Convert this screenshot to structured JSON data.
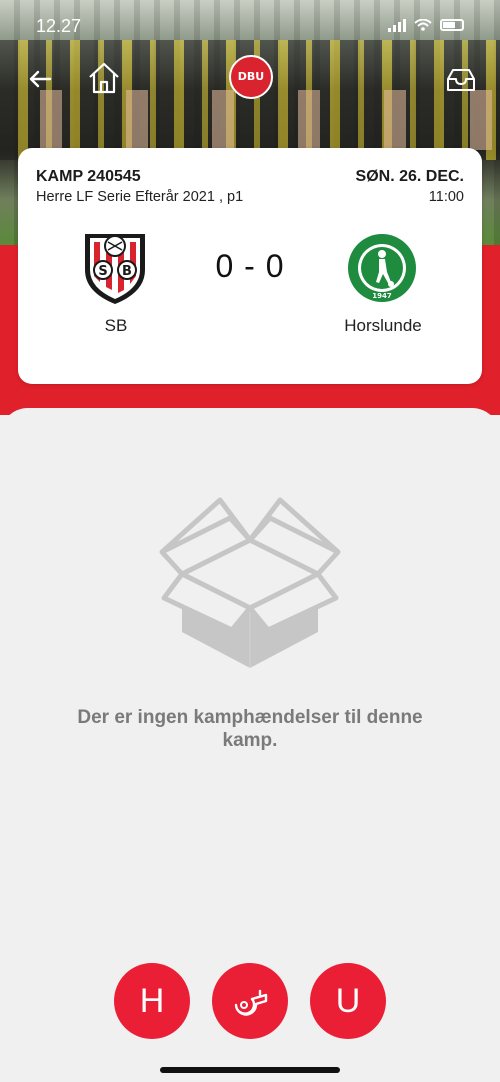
{
  "status_bar": {
    "time": "12.27"
  },
  "header": {
    "logo_text": "DBU"
  },
  "match": {
    "match_id": "KAMP 240545",
    "league": "Herre LF Serie Efterår 2021 , p1",
    "date": "SØN. 26. DEC.",
    "time": "11:00",
    "score": "0 - 0",
    "home_team": {
      "name": "SB",
      "crest_text": "SB",
      "crest_colors": [
        "#1a1a1a",
        "#d9232e",
        "#ffffff"
      ]
    },
    "away_team": {
      "name": "Horslunde",
      "crest_text": "HORSLUNDE BOLDKLUB",
      "crest_year": "1947",
      "crest_color": "#1f8b3f"
    }
  },
  "empty_state": {
    "icon": "open-box-icon",
    "message": "Der er ingen kamphændelser til denne kamp."
  },
  "actions": {
    "home_label": "H",
    "event_icon": "whistle-icon",
    "away_label": "U"
  },
  "colors": {
    "brand_red": "#e0202b",
    "button_red": "#ea1f36",
    "muted_text": "#7a7a7a"
  }
}
